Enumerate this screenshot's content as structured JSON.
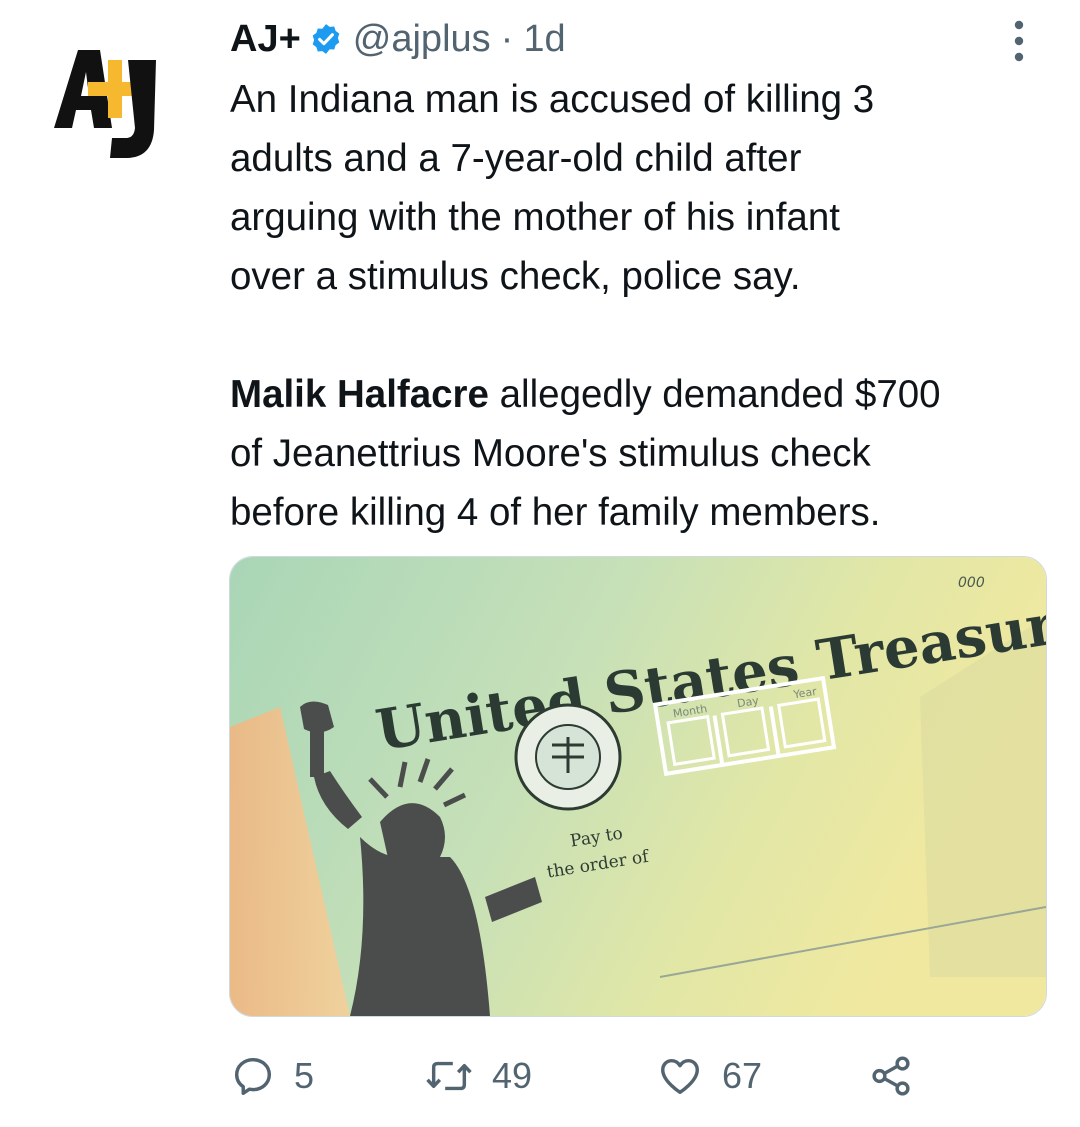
{
  "tweet": {
    "author": {
      "name": "AJ+",
      "handle": "@ajplus",
      "separator": "·",
      "time": "1d",
      "verified": true,
      "avatar_text": "AJ+"
    },
    "text": {
      "para1_lines": [
        "An Indiana man is accused of killing 3",
        "adults and a 7-year-old child after",
        "arguing with the mother of his infant",
        "over a stimulus check, police say."
      ],
      "para2_bold": "Malik Halfacre",
      "para2_line1_rest": " allegedly demanded $700",
      "para2_lines": [
        "of Jeanettrius Moore's stimulus check",
        "before killing 4 of her family members."
      ]
    },
    "image": {
      "title": "United States Treasury",
      "corner": "000",
      "date_labels": [
        "Month",
        "Day",
        "Year"
      ],
      "pay_to_line1": "Pay to",
      "pay_to_line2": "the order of",
      "icon": "statue-of-liberty-check-image"
    },
    "actions": {
      "reply_count": "5",
      "retweet_count": "49",
      "like_count": "67"
    }
  },
  "colors": {
    "verified": "#1d9bf0",
    "secondary_text": "#536471",
    "logo_yellow": "#f5b82e"
  }
}
